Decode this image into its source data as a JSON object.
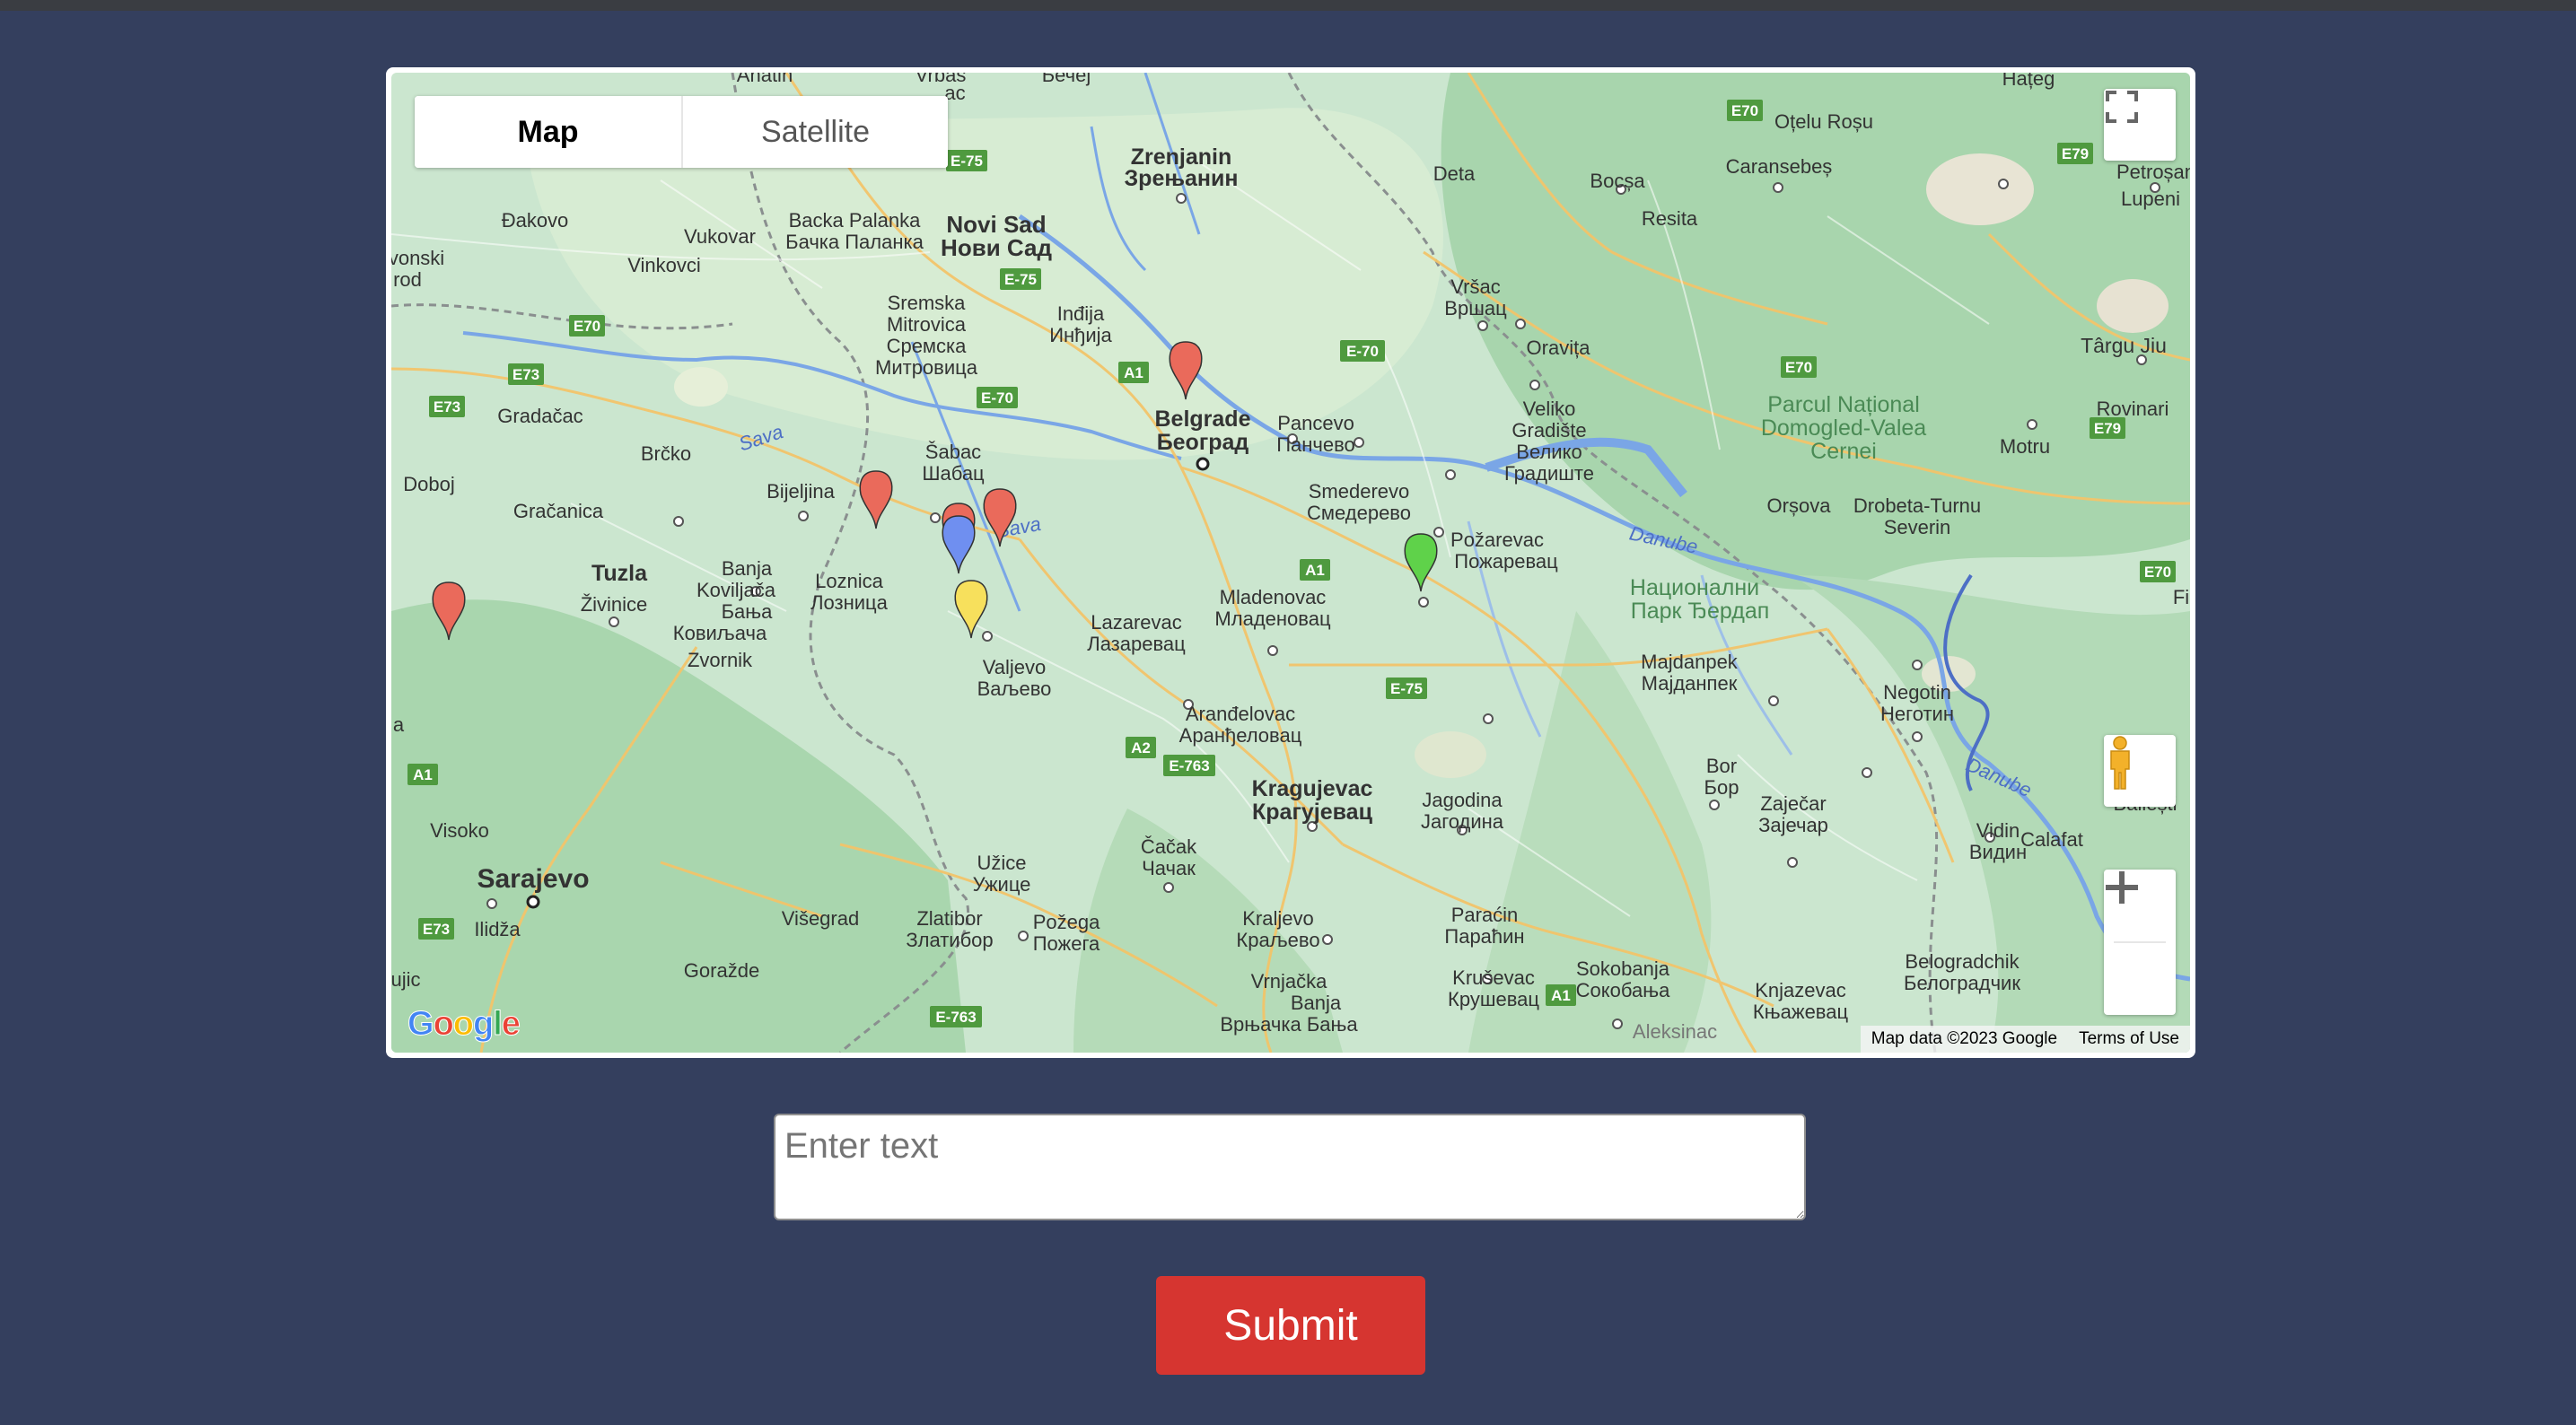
{
  "map": {
    "type_control": {
      "map_label": "Map",
      "satellite_label": "Satellite",
      "selected": "Map"
    },
    "attribution": {
      "data_label": "Map data ©2023 Google",
      "terms_label": "Terms of Use"
    },
    "logo_text": "Google",
    "icons": {
      "fullscreen": "fullscreen-icon",
      "pegman": "pegman-icon",
      "zoom_in": "plus-icon",
      "zoom_out": "minus-icon"
    },
    "marker_colors": {
      "red": "#ea6a5b",
      "blue": "#6f8ff0",
      "yellow": "#f7e05c",
      "green": "#5fd24a"
    },
    "places": {
      "zrenjanin": "Zrenjanin",
      "zrenjanin_cyr": "Зрењанин",
      "novi_sad": "Novi Sad",
      "novi_sad_cyr": "Нови Сад",
      "belgrade": "Belgrade",
      "belgrade_cyr": "Београд",
      "pancevo": "Pancevo",
      "pancevo_cyr": "Панчево",
      "smederevo": "Smederevo",
      "smederevo_cyr": "Смедерево",
      "pozarevac": "Požarevac",
      "pozarevac_cyr": "Пожаревац",
      "sabac": "Šabac",
      "sabac_cyr": "Шабац",
      "loznica": "Loznica",
      "loznica_cyr": "Лозница",
      "valjevo": "Valjevo",
      "valjevo_cyr": "Ваљево",
      "lazarevac": "Lazarevac",
      "lazarevac_cyr": "Лазаревац",
      "mladenovac": "Mladenovac",
      "mladenovac_cyr": "Младеновац",
      "arandjelovac": "Aranđelovac",
      "arandjelovac_cyr": "Аранђеловац",
      "kragujevac": "Kragujevac",
      "kragujevac_cyr": "Крагујевац",
      "jagodina": "Jagodina",
      "jagodina_cyr": "Јагодина",
      "cacak": "Čačak",
      "cacak_cyr": "Чачак",
      "uzice": "Užice",
      "uzice_cyr": "Ужице",
      "pozega": "Požega",
      "pozega_cyr": "Пожега",
      "kraljevo": "Kraljevo",
      "kraljevo_cyr": "Краљево",
      "krusevac": "Kruševac",
      "krusevac_cyr": "Крушевац",
      "paracin": "Paraćin",
      "paracin_cyr": "Параћин",
      "zajecar": "Zaječar",
      "zajecar_cyr": "Зајечар",
      "bor": "Bor",
      "bor_cyr": "Бор",
      "negotin": "Negotin",
      "negotin_cyr": "Неготин",
      "majdanpek": "Majdanpek",
      "majdanpek_cyr": "Мајданпек",
      "vidin": "Vidin",
      "vidin_cyr": "Видин",
      "calafat": "Calafat",
      "sarajevo": "Sarajevo",
      "tuzla": "Tuzla",
      "zvornik": "Zvornik",
      "bijeljina": "Bijeljina",
      "brcko": "Brčko",
      "doboj": "Doboj",
      "visoko": "Visoko",
      "ilidza": "Ilidža",
      "gorazde": "Goražde",
      "visegrad": "Višegrad",
      "vrsac": "Vršac",
      "vrsac_cyr": "Вршац",
      "deta": "Deta",
      "bocsa": "Bocșa",
      "resita": "Resita",
      "oravita": "Oravița",
      "caransebes": "Caransebeș",
      "otelu_rosu": "Oțelu Roșu",
      "hateg": "Hațeg",
      "lupeni": "Lupeni",
      "targu_jiu": "Târgu Jiu",
      "rovinari": "Rovinari",
      "motru": "Motru",
      "orsova": "Orșova",
      "drobeta": "Drobeta-Turnu",
      "drobeta2": "Severin",
      "park_ro": "Parcul Național",
      "park_ro2": "Domogled-Valea",
      "park_ro3": "Cernei",
      "djerdap": "Национални",
      "djerdap2": "Парк Ђердап",
      "veliko_gradiste": "Veliko",
      "veliko_gradiste2": "Gradište",
      "veliko_gradiste_cyr": "Велико",
      "veliko_gradiste_cyr2": "Градиште",
      "danube": "Danube",
      "sava": "Sava",
      "sokobanja": "Sokobanja",
      "sokobanja_cyr": "Сокобања",
      "knjazevac": "Knjazevac",
      "knjazevac_cyr": "Књажевац",
      "belogradchik": "Belogradchik",
      "belogradchik_cyr": "Белоградчик",
      "zlatibor": "Zlatibor",
      "zlatibor_cyr": "Златибор",
      "vrnjacka": "Vrnjačka",
      "vrnjacka2": "Banja",
      "vrnjacka_cyr": "Врњачка Бања",
      "indjija": "Inđija",
      "indjija_cyr": "Инђија",
      "sremska": "Sremska",
      "sremska2": "Mitrovica",
      "sremska_cyr": "Сремска",
      "sremska_cyr2": "Митровица",
      "backa_palanka": "Backa Palanka",
      "backa_palanka_cyr": "Бачка Паланка",
      "djakovo": "Đakovo",
      "vukovar": "Vukovar",
      "vinkovci": "Vinkovci",
      "gradacac": "Gradačac",
      "gracanica": "Gračanica",
      "zivinice": "Živinice",
      "banja_koviljaca": "Banja",
      "banja_koviljaca2": "Koviljača",
      "banja_koviljaca_cyr": "Бања",
      "banja_koviljaca_cyr2": "Ковиљача",
      "aleksinac": "Aleksinac",
      "bailesti": "Băilești",
      "fi": "Fi",
      "vonski": "vonski",
      "brod": "rod",
      "anatin": "Anatin",
      "vrbas": "Vrbas",
      "bechej": "Бечеј",
      "vac": "ac",
      "petrosan": "Petroșan",
      "uijic": "ujic",
      "la": "a"
    },
    "roads": {
      "e75": "E-75",
      "e70": "E-70",
      "e763": "E-763",
      "a1": "A1",
      "a2": "A2",
      "e70b": "E70",
      "e73": "E73",
      "e79": "E79"
    }
  },
  "form": {
    "input_placeholder": "Enter text",
    "input_value": "",
    "submit_label": "Submit"
  }
}
